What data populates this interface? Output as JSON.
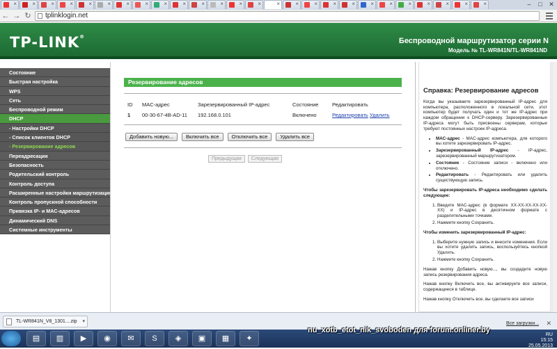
{
  "browser": {
    "url": "tplinklogin.net",
    "tab_count": 26
  },
  "header": {
    "logo": "TP-LINK",
    "title": "Беспроводной маршрутизатор серии N",
    "model": "Модель № TL-WR841N/TL-WR841ND"
  },
  "sidebar": {
    "items": [
      {
        "label": "Состояние"
      },
      {
        "label": "Быстрая настройка"
      },
      {
        "label": "WPS"
      },
      {
        "label": "Сеть"
      },
      {
        "label": "Беспроводной режим"
      },
      {
        "label": "DHCP"
      },
      {
        "label": "- Настройки DHCP"
      },
      {
        "label": "- Список клиентов DHCP"
      },
      {
        "label": "- Резервирование адресов"
      },
      {
        "label": "Переадресация"
      },
      {
        "label": "Безопасность"
      },
      {
        "label": "Родительский контроль"
      },
      {
        "label": "Контроль доступа"
      },
      {
        "label": "Расширенные настройки маршрутизации"
      },
      {
        "label": "Контроль пропускной способности"
      },
      {
        "label": "Привязка IP- и MAC-адресов"
      },
      {
        "label": "Динамический DNS"
      },
      {
        "label": "Системные инструменты"
      }
    ]
  },
  "main": {
    "section_title": "Резервирование адресов",
    "columns": [
      "ID",
      "MAC-адрес",
      "Зарезервированный IP-адрес",
      "Состояние",
      "Редактировать"
    ],
    "rows": [
      {
        "id": "1",
        "mac": "00-30-67-4B-AD-11",
        "ip": "192.168.0.101",
        "state": "Включено",
        "edit": "Редактировать",
        "delete": "Удалить"
      }
    ],
    "buttons": {
      "add": "Добавить новую...",
      "enable_all": "Включить все",
      "disable_all": "Отключить все",
      "delete_all": "Удалить все"
    },
    "pager": {
      "prev": "Предыдущая",
      "next": "Следующая"
    }
  },
  "help": {
    "title": "Справка: Резервирование адресов",
    "intro": "Когда вы указываете зарезервированный IP-адрес для компьютера, расположенного в локальной сети, этот компьютер будет получать один и тот же IP-адрес при каждом обращении к DHCP-серверу. Зарезервированные IP-адреса могут быть присвоены серверам, которые требуют постоянных настроек IP-адреса.",
    "bullets": [
      {
        "term": "MAC-адрес",
        "text": " - MAC-адрес компьютера, для которого вы хотите зарезервировать IP-адрес."
      },
      {
        "term": "Зарезервированный IP-адрес",
        "text": " - IP-адрес, зарезервированный маршрутизатором."
      },
      {
        "term": "Состояние",
        "text": " - Состояние записи - включено или отключено."
      },
      {
        "term": "Редактировать",
        "text": " - Редактировать или удалить существующую запись."
      }
    ],
    "reserve_heading": "Чтобы зарезервировать IP-адреса необходимо сделать следующее:",
    "reserve_steps": [
      "Введите MAC-адрес (в формате XX-XX-XX-XX-XX-XX) и IP-адрес в десятичном формате с разделительными точками.",
      "Нажмите кнопку Сохранить."
    ],
    "edit_heading": "Чтобы изменить зарезервированный IP-адрес:",
    "edit_steps": [
      "Выберите нужную запись и внесите изменения. Если вы хотите удалить запись, воспользуйтесь кнопкой Удалить.",
      "Нажмите кнопку Сохранить."
    ],
    "p_add": "Нажав кнопку Добавить новую..., вы создадите новую запись резервирования адреса.",
    "p_enable": "Нажав кнопку Включить все, вы активируете все записи, содержащиеся в таблице.",
    "p_disable": "Нажав кнопку Отключить все, вы сделаете все записи"
  },
  "downloads": {
    "file": "TL-WR841N_V8_1301....zip",
    "all": "Все загрузки..."
  },
  "watermark": "nu_xotb_etot_nik_svoboden для forum.onliner.by",
  "tray": {
    "lang": "RU",
    "time": "15:15",
    "date": "25.05.2013"
  }
}
